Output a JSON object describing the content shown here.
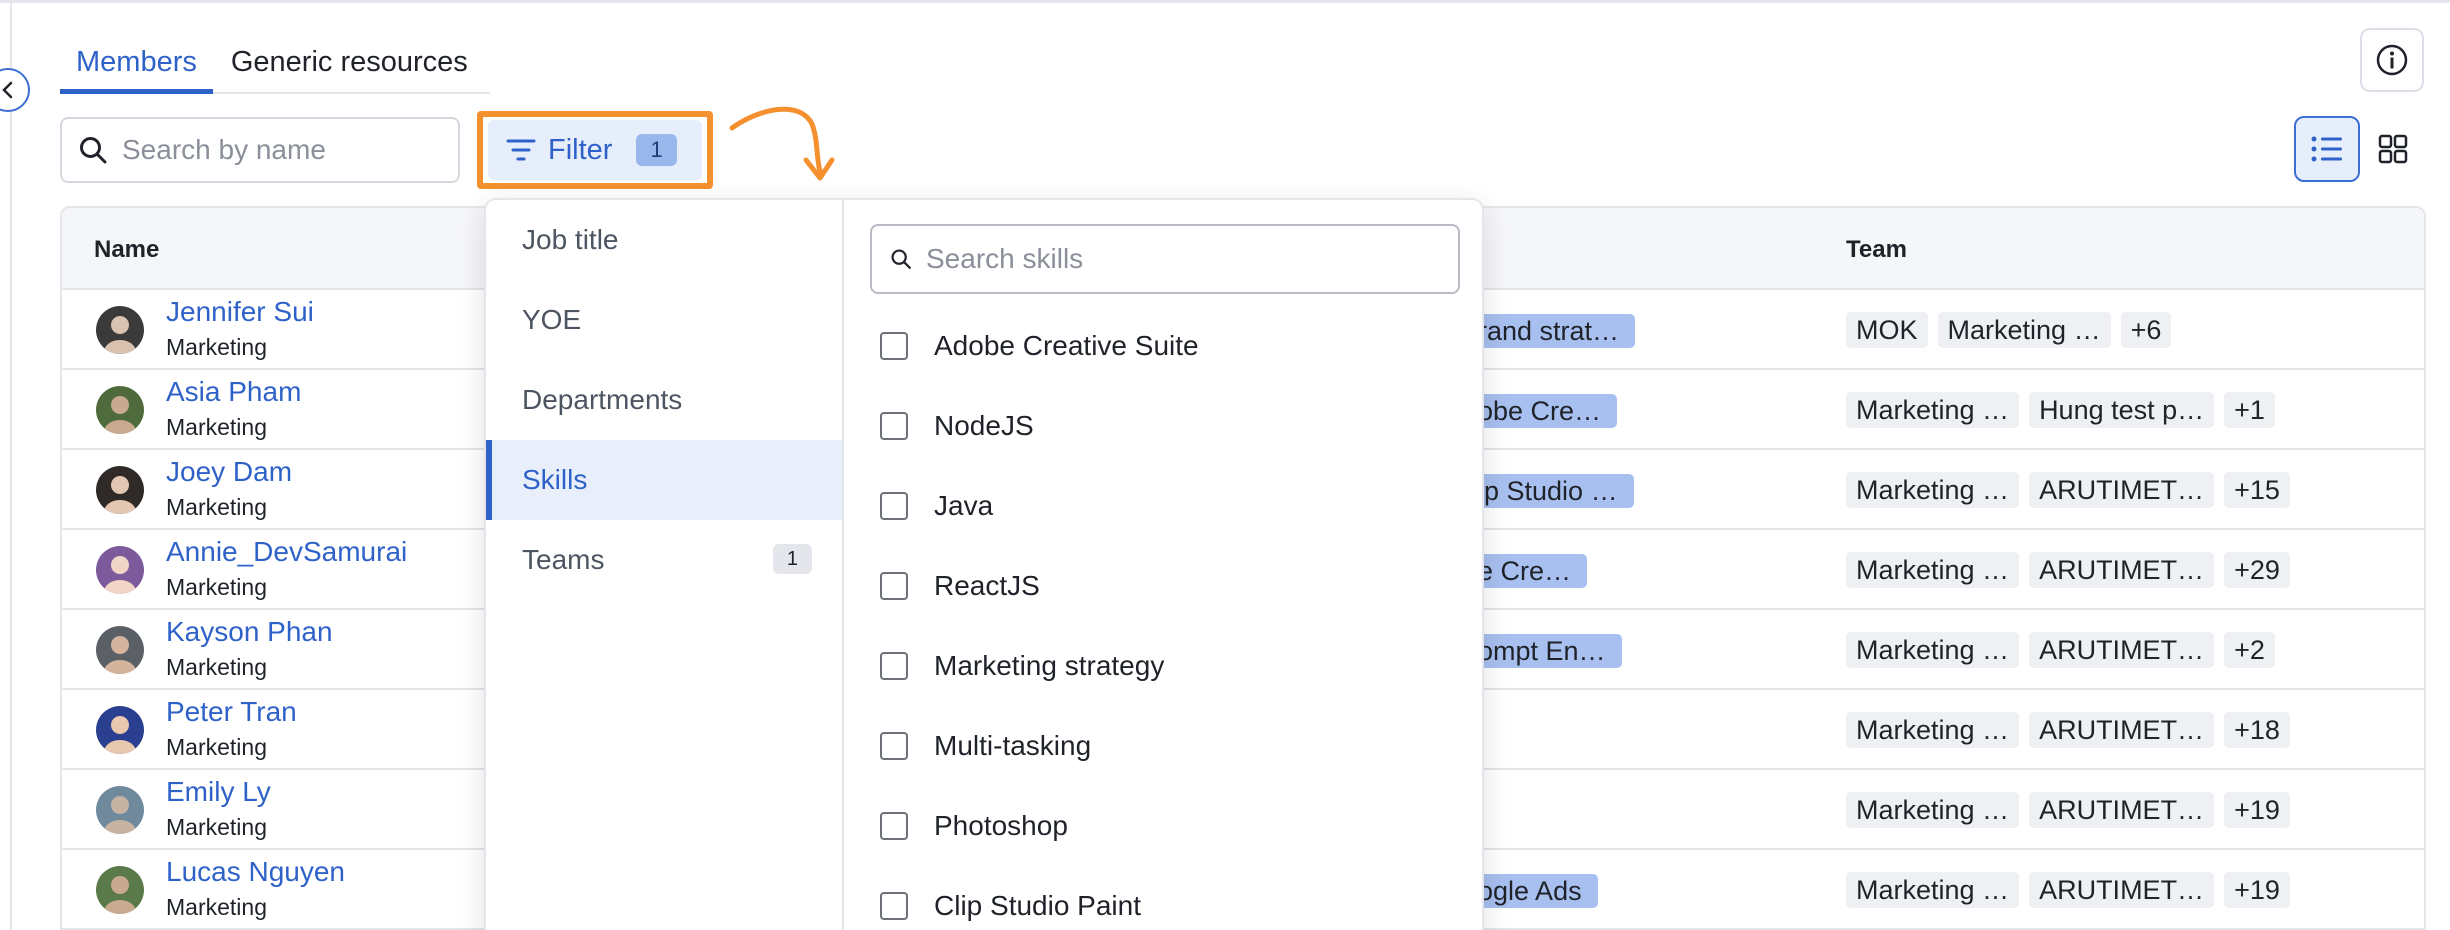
{
  "tabs": [
    {
      "label": "Members",
      "active": true
    },
    {
      "label": "Generic resources",
      "active": false
    }
  ],
  "search": {
    "placeholder": "Search by name"
  },
  "filter": {
    "label": "Filter",
    "count": "1",
    "highlight_color": "#f5902f"
  },
  "table": {
    "columns": {
      "name": "Name",
      "team": "Team"
    },
    "rows": [
      {
        "name": "Jennifer Sui",
        "dept": "Marketing",
        "skill": "rand strat…",
        "teams": [
          "MOK",
          "Marketing …",
          "+6"
        ]
      },
      {
        "name": "Asia Pham",
        "dept": "Marketing",
        "skill": "obe Cre…",
        "teams": [
          "Marketing …",
          "Hung test p…",
          "+1"
        ]
      },
      {
        "name": "Joey Dam",
        "dept": "Marketing",
        "skill": "ip Studio …",
        "teams": [
          "Marketing …",
          "ARUTIMET…",
          "+15"
        ]
      },
      {
        "name": "Annie_DevSamurai",
        "dept": "Marketing",
        "skill": "e Cre…",
        "teams": [
          "Marketing …",
          "ARUTIMET…",
          "+29"
        ]
      },
      {
        "name": "Kayson Phan",
        "dept": "Marketing",
        "skill": "ompt En…",
        "teams": [
          "Marketing …",
          "ARUTIMET…",
          "+2"
        ]
      },
      {
        "name": "Peter Tran",
        "dept": "Marketing",
        "skill": "",
        "teams": [
          "Marketing …",
          "ARUTIMET…",
          "+18"
        ]
      },
      {
        "name": "Emily Ly",
        "dept": "Marketing",
        "skill": "",
        "teams": [
          "Marketing …",
          "ARUTIMET…",
          "+19"
        ]
      },
      {
        "name": "Lucas Nguyen",
        "dept": "Marketing",
        "skill": "ogle Ads",
        "teams": [
          "Marketing …",
          "ARUTIMET…",
          "+19"
        ]
      }
    ]
  },
  "dropdown": {
    "categories": [
      {
        "label": "Job title",
        "badge": ""
      },
      {
        "label": "YOE",
        "badge": ""
      },
      {
        "label": "Departments",
        "badge": ""
      },
      {
        "label": "Skills",
        "badge": "",
        "active": true
      },
      {
        "label": "Teams",
        "badge": "1"
      }
    ],
    "skills_search_placeholder": "Search skills",
    "skills": [
      "Adobe Creative Suite",
      "NodeJS",
      "Java",
      "ReactJS",
      "Marketing strategy",
      "Multi-tasking",
      "Photoshop",
      "Clip Studio Paint"
    ]
  },
  "colors": {
    "accent": "#2f62c9",
    "skill_tag": "#a8c0f0",
    "team_chip": "#eef0f3"
  }
}
